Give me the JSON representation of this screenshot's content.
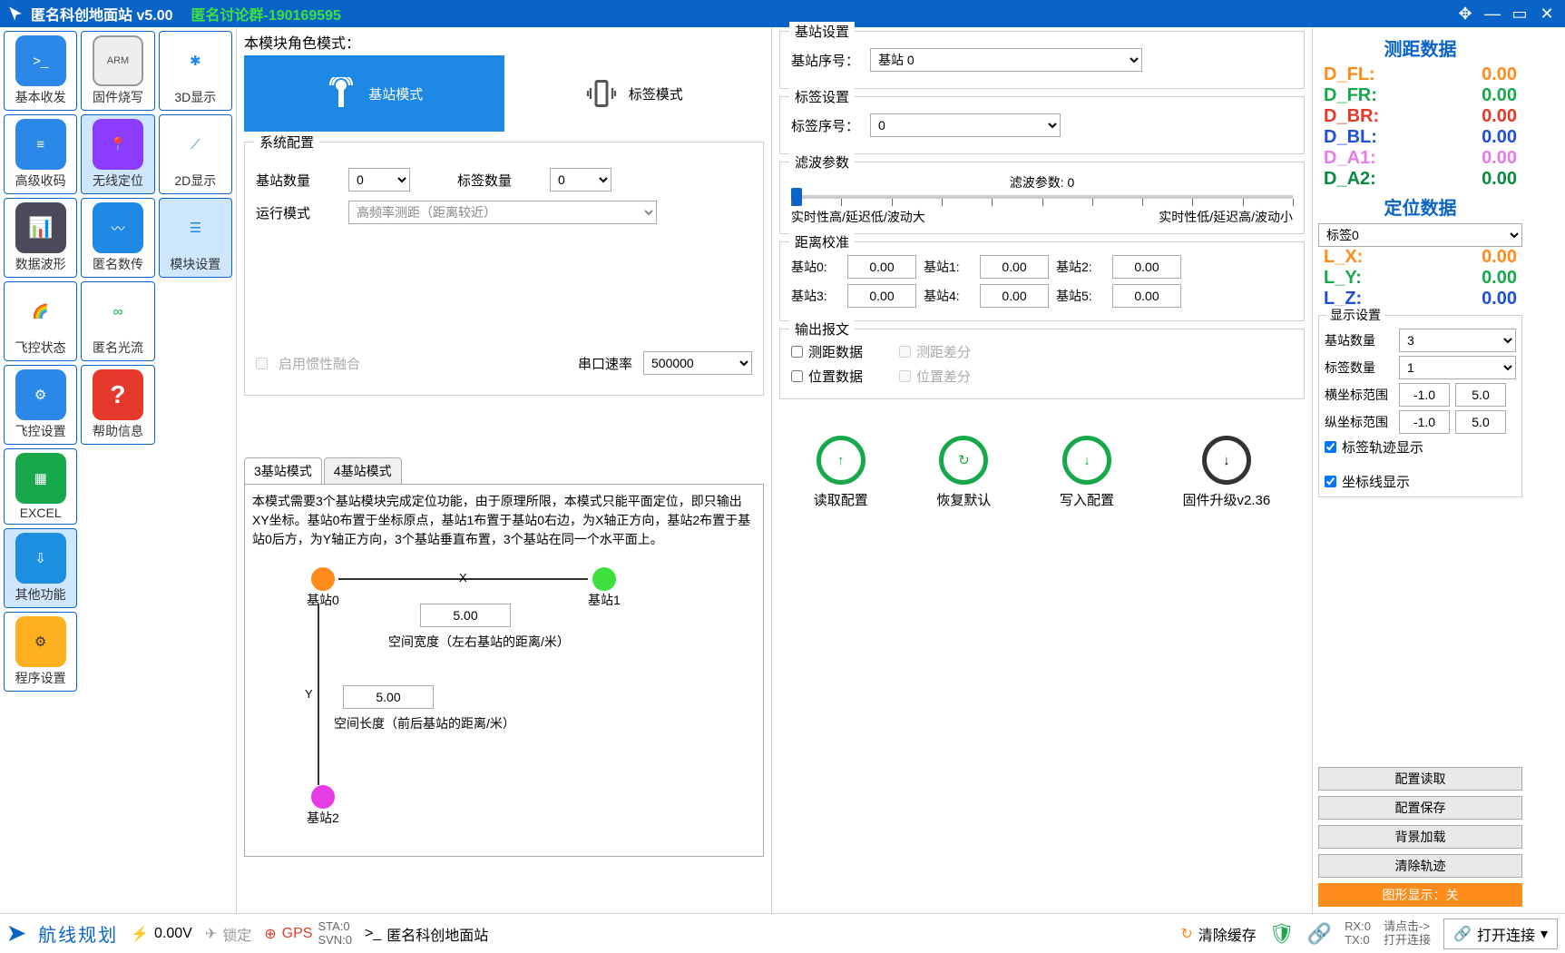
{
  "title": "匿名科创地面站 v5.00",
  "subtitle": "匿名讨论群-190169595",
  "sidebar": {
    "col1": [
      {
        "label": "基本收发",
        "bg": "#2c88e8"
      },
      {
        "label": "高级收码",
        "bg": "#2c88e8"
      },
      {
        "label": "数据波形",
        "bg": "#ffffff"
      },
      {
        "label": "飞控状态",
        "bg": "#ffffff"
      },
      {
        "label": "飞控设置",
        "bg": "#2c88e8"
      },
      {
        "label": "EXCEL",
        "bg": "#17a84c"
      },
      {
        "label": "其他功能",
        "bg": "#1d8fe1"
      },
      {
        "label": "程序设置",
        "bg": "#ffb020"
      }
    ],
    "col2": [
      {
        "label": "固件烧写",
        "bg": "#eee"
      },
      {
        "label": "无线定位",
        "bg": "#8c3cff"
      },
      {
        "label": "匿名数传",
        "bg": "#1e88e5"
      },
      {
        "label": "匿名光流",
        "bg": "#ffffff"
      },
      {
        "label": "帮助信息",
        "bg": "#e5392b"
      }
    ],
    "col3": [
      {
        "label": "3D显示",
        "bg": "#fff"
      },
      {
        "label": "2D显示",
        "bg": "#fff"
      },
      {
        "label": "模块设置",
        "bg": "#fff"
      }
    ]
  },
  "mid": {
    "mode_label": "本模块角色模式：",
    "mode_base": "基站模式",
    "mode_tag": "标签模式",
    "sys_title": "系统配置",
    "base_count_lbl": "基站数量",
    "base_count": "0",
    "tag_count_lbl": "标签数量",
    "tag_count": "0",
    "run_mode_lbl": "运行模式",
    "run_mode": "高频率测距（距离较近）",
    "inertial_lbl": "启用惯性融合",
    "baud_lbl": "串口速率",
    "baud": "500000",
    "tab3": "3基站模式",
    "tab4": "4基站模式",
    "tab3_desc": "本模式需要3个基站模块完成定位功能，由于原理所限，本模式只能平面定位，即只输出XY坐标。基站0布置于坐标原点，基站1布置于基站0右边，为X轴正方向，基站2布置于基站0后方，为Y轴正方向，3个基站垂直布置，3个基站在同一个水平面上。",
    "bs0": "基站0",
    "bs1": "基站1",
    "bs2": "基站2",
    "width_val": "5.00",
    "width_lbl": "空间宽度（左右基站的距离/米）",
    "height_val": "5.00",
    "height_lbl": "空间长度（前后基站的距离/米）"
  },
  "rconf": {
    "base_set_title": "基站设置",
    "base_idx_lbl": "基站序号：",
    "base_idx": "基站 0",
    "tag_set_title": "标签设置",
    "tag_idx_lbl": "标签序号：",
    "tag_idx": "0",
    "filter_title": "滤波参数",
    "filter_val": "滤波参数: 0",
    "filter_left": "实时性高/延迟低/波动大",
    "filter_right": "实时性低/延迟高/波动小",
    "cal_title": "距离校准",
    "cal": {
      "b0": "基站0:",
      "b1": "基站1:",
      "b2": "基站2:",
      "b3": "基站3:",
      "b4": "基站4:",
      "b5": "基站5:",
      "v": "0.00"
    },
    "out_title": "输出报文",
    "out_dist": "测距数据",
    "out_distdiff": "测距差分",
    "out_pos": "位置数据",
    "out_posdiff": "位置差分",
    "act_read": "读取配置",
    "act_reset": "恢复默认",
    "act_write": "写入配置",
    "act_fw": "固件升级v2.36"
  },
  "rdata": {
    "dist_title": "测距数据",
    "D_FL": {
      "lbl": "D_FL:",
      "v": "0.00",
      "c": "#ff8c1a"
    },
    "D_FR": {
      "lbl": "D_FR:",
      "v": "0.00",
      "c": "#17a84c"
    },
    "D_BR": {
      "lbl": "D_BR:",
      "v": "0.00",
      "c": "#e5392b"
    },
    "D_BL": {
      "lbl": "D_BL:",
      "v": "0.00",
      "c": "#1e4fd8"
    },
    "D_A1": {
      "lbl": "D_A1:",
      "v": "0.00",
      "c": "#e57ce5"
    },
    "D_A2": {
      "lbl": "D_A2:",
      "v": "0.00",
      "c": "#0a8a3c"
    },
    "loc_title": "定位数据",
    "tag_sel": "标签0",
    "L_X": {
      "lbl": "L_X:",
      "v": "0.00",
      "c": "#ff8c1a"
    },
    "L_Y": {
      "lbl": "L_Y:",
      "v": "0.00",
      "c": "#17a84c"
    },
    "L_Z": {
      "lbl": "L_Z:",
      "v": "0.00",
      "c": "#1e4fd8"
    },
    "disp_title": "显示设置",
    "disp_bs_lbl": "基站数量",
    "disp_bs": "3",
    "disp_tag_lbl": "标签数量",
    "disp_tag": "1",
    "hx_lbl": "横坐标范围",
    "hx_lo": "-1.0",
    "hx_hi": "5.0",
    "vy_lbl": "纵坐标范围",
    "vy_lo": "-1.0",
    "vy_hi": "5.0",
    "ck_trace": "标签轨迹显示",
    "ck_axis": "坐标线显示",
    "btn_read": "配置读取",
    "btn_save": "配置保存",
    "btn_bg": "背景加载",
    "btn_clear": "清除轨迹",
    "btn_graph": "图形显示：关"
  },
  "status": {
    "route": "航线规划",
    "volt": "0.00V",
    "lock": "锁定",
    "gps": "GPS",
    "sta": "STA:0",
    "svn": "SVN:0",
    "name": "匿名科创地面站",
    "clear": "清除缓存",
    "rx": "RX:0",
    "tx": "TX:0",
    "hint1": "请点击->",
    "hint2": "打开连接",
    "open": "打开连接"
  }
}
